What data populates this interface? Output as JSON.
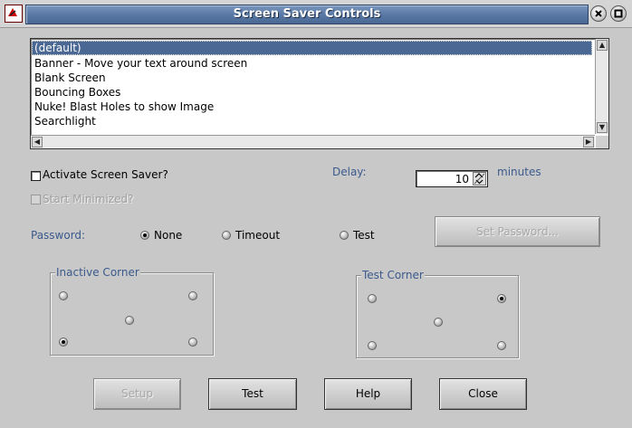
{
  "window": {
    "title": "Screen Saver Controls",
    "icons": {
      "app": "app-icon",
      "minimize": "minimize-icon",
      "close": "close-icon"
    }
  },
  "saver_list": {
    "items": [
      "(default)",
      "Banner - Move your text around screen",
      "Blank Screen",
      "Bouncing Boxes",
      "Nuke! Blast Holes to show Image",
      "Searchlight"
    ],
    "selected": "(default)"
  },
  "options": {
    "activate_label": "Activate Screen Saver?",
    "activate_checked": false,
    "start_minimized_label": "Start Minimized?",
    "start_minimized_checked": false,
    "start_minimized_enabled": false
  },
  "delay": {
    "label": "Delay:",
    "value": "10",
    "unit": "minutes"
  },
  "password": {
    "label": "Password:",
    "choices": [
      "None",
      "Timeout",
      "Test"
    ],
    "selected": "None",
    "set_button": "Set Password...",
    "set_button_enabled": false
  },
  "inactive_corner": {
    "title": "Inactive Corner",
    "selected": "bottom-left"
  },
  "test_corner": {
    "title": "Test Corner",
    "selected": "top-right"
  },
  "buttons": {
    "setup": "Setup",
    "setup_enabled": false,
    "test": "Test",
    "help": "Help",
    "close": "Close"
  },
  "colors": {
    "title_bar": "#5a79a6",
    "selection": "#4a6893",
    "label_blue": "#3b5a8c",
    "background": "#c8c8c8"
  }
}
